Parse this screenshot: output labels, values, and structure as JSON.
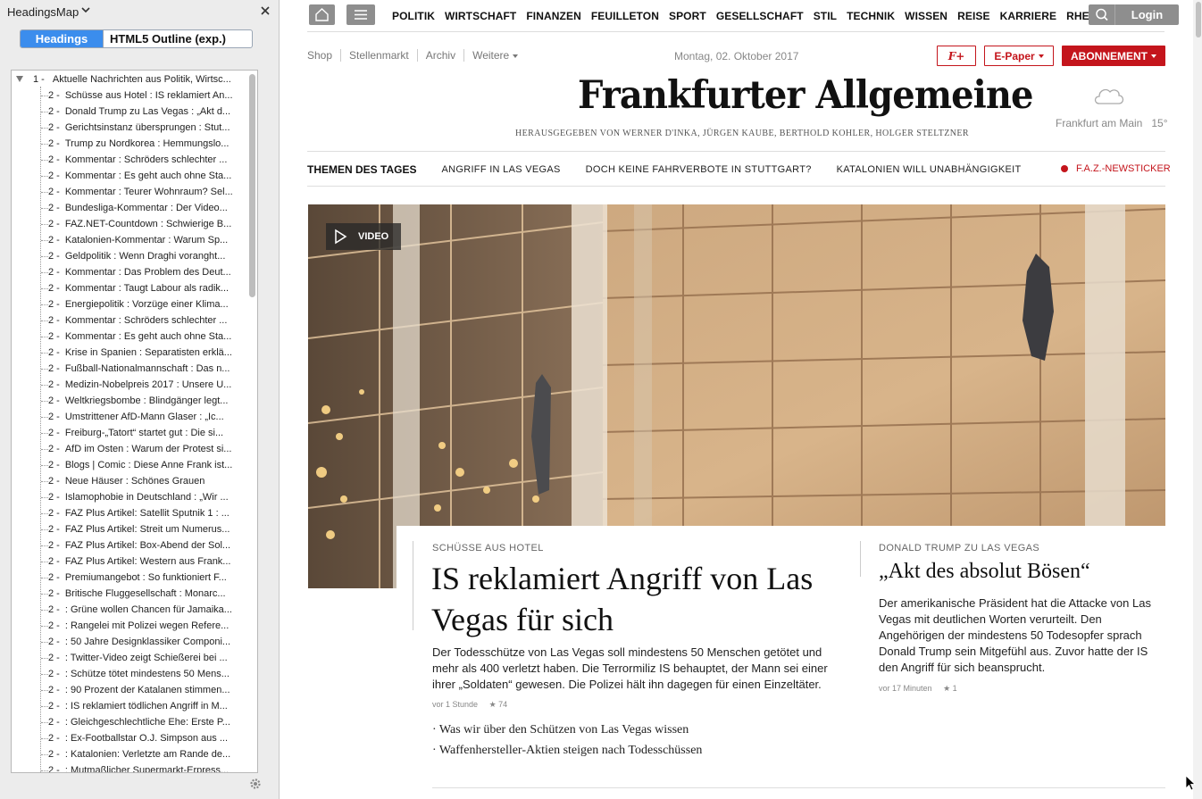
{
  "sidebar": {
    "title": "HeadingsMap",
    "tabs": [
      "Headings",
      "HTML5 Outline (exp.)"
    ],
    "root": {
      "level": "1 -",
      "text": "Aktuelle Nachrichten aus Politik, Wirtsc..."
    },
    "items": [
      "Schüsse aus Hotel : IS reklamiert An...",
      "Donald Trump zu Las Vegas : „Akt d...",
      "Gerichtsinstanz übersprungen : Stut...",
      "Trump zu Nordkorea : Hemmungslo...",
      "Kommentar : Schröders schlechter ...",
      "Kommentar : Es geht auch ohne Sta...",
      "Kommentar : Teurer Wohnraum? Sel...",
      "Bundesliga-Kommentar : Der Video...",
      "FAZ.NET-Countdown : Schwierige B...",
      "Katalonien-Kommentar : Warum Sp...",
      "Geldpolitik : Wenn Draghi voranght...",
      "Kommentar : Das Problem des Deut...",
      "Kommentar : Taugt Labour als radik...",
      "Energiepolitik : Vorzüge einer Klima...",
      "Kommentar : Schröders schlechter ...",
      "Kommentar : Es geht auch ohne Sta...",
      "Krise in Spanien : Separatisten erklä...",
      "Fußball-Nationalmannschaft : Das n...",
      "Medizin-Nobelpreis 2017 : Unsere U...",
      "Weltkriegsbombe : Blindgänger legt...",
      "Umstrittener AfD-Mann Glaser : „Ic...",
      "Freiburg-„Tatort“ startet gut : Die si...",
      "AfD im Osten : Warum der Protest si...",
      "Blogs | Comic : Diese Anne Frank ist...",
      "Neue Häuser : Schönes Grauen",
      "Islamophobie in Deutschland : „Wir ...",
      "FAZ Plus Artikel: Satellit Sputnik 1 : ...",
      "FAZ Plus Artikel: Streit um Numerus...",
      "FAZ Plus Artikel: Box-Abend der Sol...",
      "FAZ Plus Artikel: Western aus Frank...",
      "Premiumangebot : So funktioniert F...",
      "Britische Fluggesellschaft : Monarc...",
      ": Grüne wollen Chancen für Jamaika...",
      ": Rangelei mit Polizei wegen Refere...",
      ": 50 Jahre Designklassiker Componi...",
      ": Twitter-Video zeigt Schießerei bei ...",
      ": Schütze tötet mindestens 50 Mens...",
      ": 90 Prozent der Katalanen stimmen...",
      ": IS reklamiert tödlichen Angriff in M...",
      ": Gleichgeschlechtliche Ehe: Erste P...",
      ": Ex-Footballstar O.J. Simpson aus ...",
      ": Katalonien: Verletzte am Rande de...",
      ": Mutmaßlicher Supermarkt-Erpress..."
    ],
    "item_level": "2 -"
  },
  "topnav": {
    "items": [
      "POLITIK",
      "WIRTSCHAFT",
      "FINANZEN",
      "FEUILLETON",
      "SPORT",
      "GESELLSCHAFT",
      "STIL",
      "TECHNIK",
      "WISSEN",
      "REISE",
      "KARRIERE",
      "RHEIN-MAIN"
    ],
    "login": "Login"
  },
  "utility": {
    "links": [
      "Shop",
      "Stellenmarkt",
      "Archiv",
      "Weitere"
    ],
    "date": "Montag, 02. Oktober 2017",
    "faz_plus": "F+",
    "epaper": "E-Paper",
    "abo": "ABONNEMENT"
  },
  "masthead": {
    "logo": "Frankfurter Allgemeine",
    "publishers": "HERAUSGEGEBEN VON WERNER D'INKA, JÜRGEN KAUBE, BERTHOLD KOHLER, HOLGER STELTZNER",
    "weather_city": "Frankfurt am Main",
    "weather_temp": "15°"
  },
  "themen": {
    "title": "THEMEN DES TAGES",
    "links": [
      "ANGRIFF IN LAS VEGAS",
      "DOCH KEINE FAHRVERBOTE IN STUTTGART?",
      "KATALONIEN WILL UNABHÄNGIGKEIT"
    ],
    "newsticker": "F.A.Z.-NEWSTICKER"
  },
  "hero": {
    "video_label": "VIDEO"
  },
  "article1": {
    "kicker": "SCHÜSSE AUS HOTEL",
    "headline": "IS reklamiert Angriff von Las Vegas für sich",
    "teaser": "Der Todesschütze von Las Vegas soll mindestens 50 Menschen getötet und mehr als 400 verletzt haben. Die Terrormiliz IS behauptet, der Mann sei einer ihrer „Soldaten“ gewesen. Die Polizei hält ihn dagegen für einen Einzeltäter.",
    "time": "vor 1 Stunde",
    "stars": "74",
    "related": [
      "Was wir über den Schützen von Las Vegas wissen",
      "Waffenhersteller-Aktien steigen nach Todesschüssen"
    ]
  },
  "article2": {
    "kicker": "DONALD TRUMP ZU LAS VEGAS",
    "headline": "„Akt des absolut Bösen“",
    "teaser": "Der amerikanische Präsident hat die Attacke von Las Vegas mit deutlichen Worten verurteilt. Den Angehörigen der mindestens 50 Todesopfer sprach Donald Trump sein Mitgefühl aus. Zuvor hatte der IS den Angriff für sich beansprucht.",
    "time": "vor 17 Minuten",
    "stars": "1"
  },
  "colors": {
    "accent": "#c4151c",
    "tab_active": "#3b8ded",
    "nav_button": "#8e8e8e"
  }
}
